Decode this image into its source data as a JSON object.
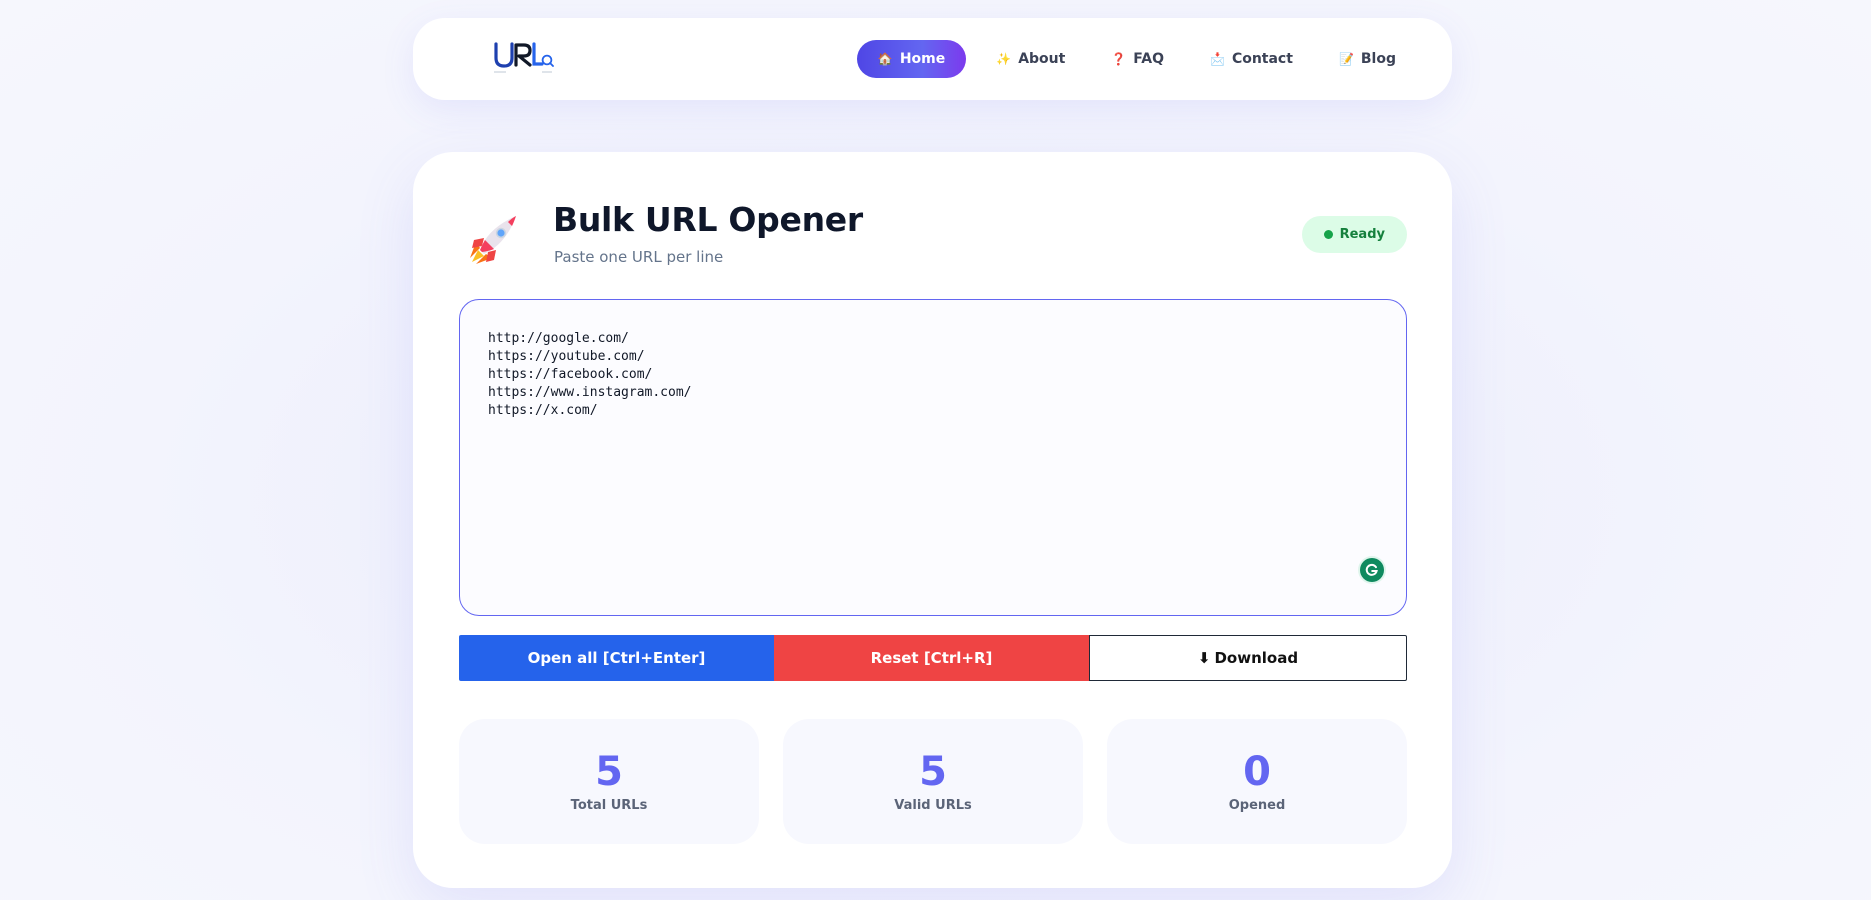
{
  "nav": {
    "logo_text": "URL",
    "logo_sub": "OPENER",
    "items": [
      {
        "icon": "🏠",
        "label": "Home"
      },
      {
        "icon": "✨",
        "label": "About"
      },
      {
        "icon": "❓",
        "label": "FAQ"
      },
      {
        "icon": "📩",
        "label": "Contact"
      },
      {
        "icon": "📝",
        "label": "Blog"
      }
    ]
  },
  "main": {
    "title": "Bulk URL Opener",
    "subtitle": "Paste one URL per line",
    "status": "Ready",
    "urls": "http://google.com/\nhttps://youtube.com/\nhttps://facebook.com/\nhttps://www.instagram.com/\nhttps://x.com/",
    "buttons": {
      "open": "Open all [Ctrl+Enter]",
      "reset": "Reset [Ctrl+R]",
      "download_icon": "⬇",
      "download": "Download"
    },
    "stats": [
      {
        "value": "5",
        "label": "Total URLs"
      },
      {
        "value": "5",
        "label": "Valid URLs"
      },
      {
        "value": "0",
        "label": "Opened"
      }
    ]
  },
  "colors": {
    "accent": "#6366f1",
    "open_button": "#2563eb",
    "reset_button": "#ef4444",
    "status_text": "#15803d",
    "status_bg": "#dcfce7"
  }
}
